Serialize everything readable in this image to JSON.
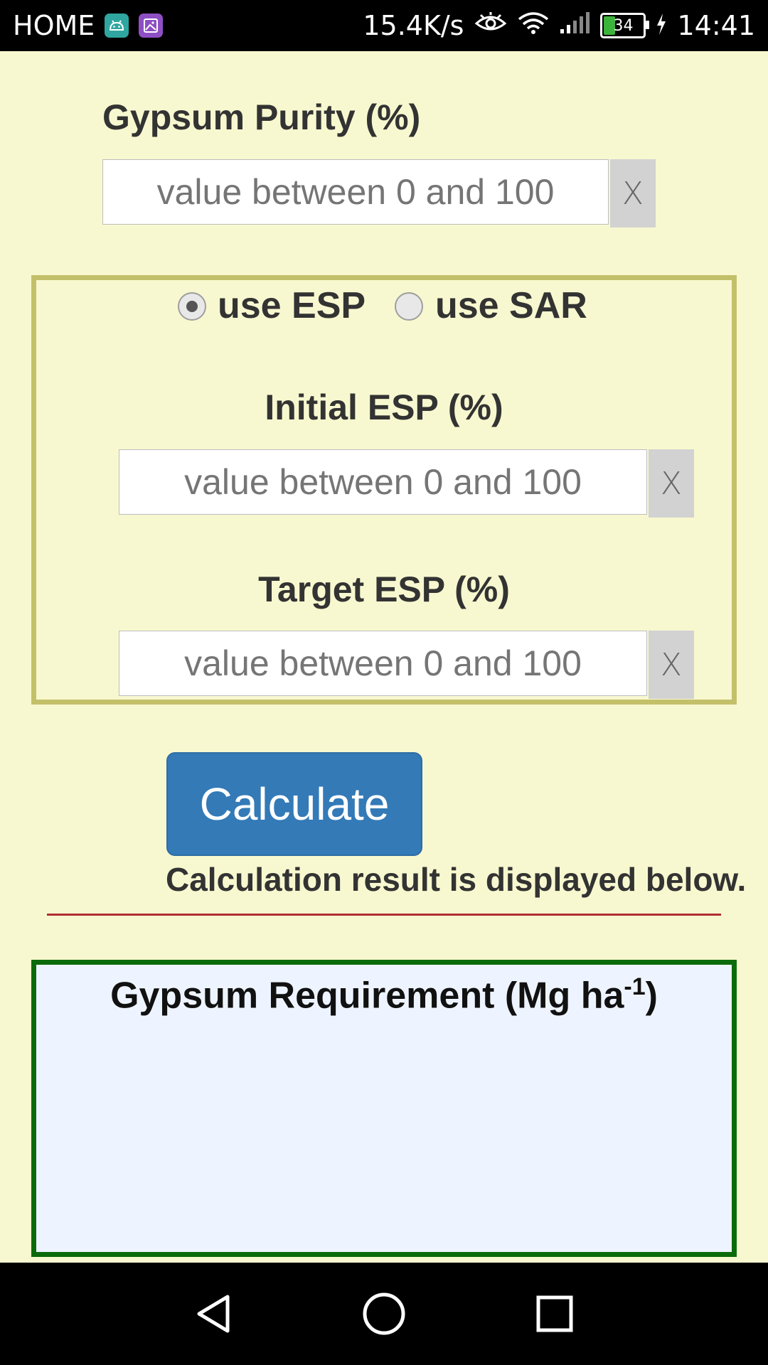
{
  "status_bar": {
    "left_label": "HOME",
    "left_icons": [
      "android-icon",
      "gallery-icon"
    ],
    "net_speed": "15.4K/s",
    "icons": [
      "eye-icon",
      "wifi-icon",
      "signal-icon"
    ],
    "battery_level": "34",
    "time": "14:41"
  },
  "gypsum_purity": {
    "label": "Gypsum Purity (%)",
    "placeholder": "value between 0 and 100",
    "clear_label": "X"
  },
  "mode": {
    "options": [
      {
        "label": "use ESP",
        "selected": true
      },
      {
        "label": "use SAR",
        "selected": false
      }
    ]
  },
  "initial_esp": {
    "label": "Initial ESP (%)",
    "placeholder": "value between 0 and 100",
    "clear_label": "X"
  },
  "target_esp": {
    "label": "Target ESP (%)",
    "placeholder": "value between 0 and 100",
    "clear_label": "X"
  },
  "calculate_label": "Calculate",
  "note": "Calculation result is displayed below.",
  "result": {
    "title": "Gypsum Requirement (Mg ha",
    "title_sup": "-1",
    "title_end": ")",
    "value": ""
  },
  "colors": {
    "background": "#f8f8d0",
    "primary_button": "#337ab7",
    "esp_border": "#c3c06a",
    "result_border": "#0b6b0b",
    "divider": "#b03030"
  }
}
